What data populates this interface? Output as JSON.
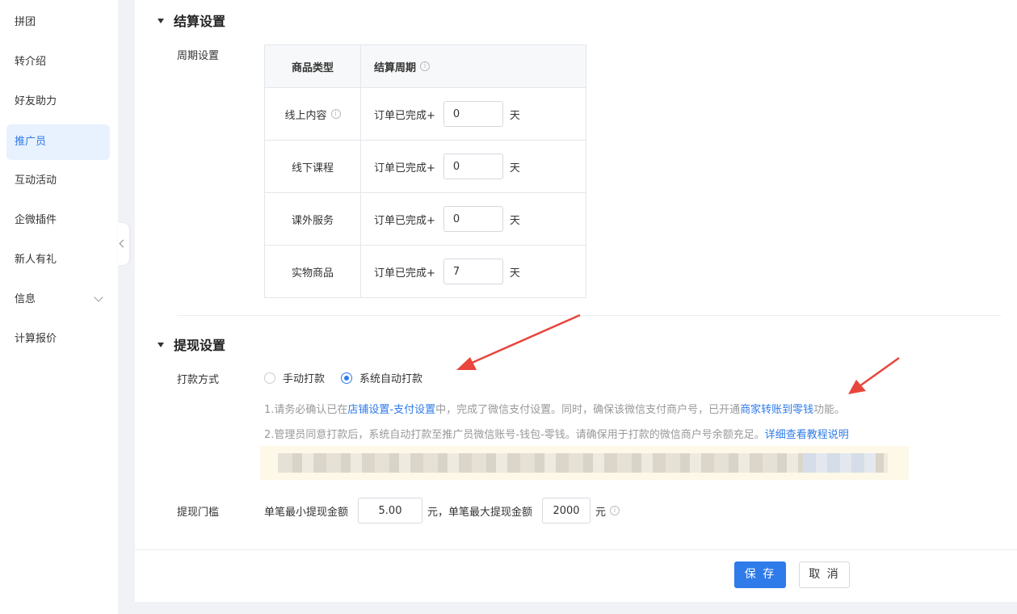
{
  "sidebar": {
    "items": [
      {
        "label": "拼团"
      },
      {
        "label": "转介绍"
      },
      {
        "label": "好友助力"
      },
      {
        "label": "推广员",
        "active": true
      },
      {
        "label": "互动活动"
      },
      {
        "label": "企微插件"
      },
      {
        "label": "新人有礼"
      },
      {
        "label": "信息",
        "has_chevron": true
      },
      {
        "label": "计算报价"
      }
    ]
  },
  "settlement": {
    "title": "结算设置",
    "period_label": "周期设置",
    "table": {
      "header_type": "商品类型",
      "header_period": "结算周期",
      "prefix": "订单已完成+",
      "unit": "天",
      "rows": [
        {
          "type": "线上内容",
          "days": "0",
          "has_info": true
        },
        {
          "type": "线下课程",
          "days": "0"
        },
        {
          "type": "课外服务",
          "days": "0"
        },
        {
          "type": "实物商品",
          "days": "7"
        }
      ]
    }
  },
  "withdraw": {
    "title": "提现设置",
    "method_label": "打款方式",
    "options": [
      {
        "label": "手动打款",
        "checked": false
      },
      {
        "label": "系统自动打款",
        "checked": true
      }
    ],
    "note1": {
      "a": "1.请务必确认已在",
      "link1": "店铺设置-支付设置",
      "b": "中，完成了微信支付设置。同时，确保该微信支付商户号，已开通",
      "link2": "商家转账到零钱",
      "c": "功能。"
    },
    "note2": {
      "a": "2.管理员同意打款后，系统自动打款至推广员微信账号-钱包-零钱。请确保用于打款的微信商户号余额充足。",
      "link": "详细查看教程说明"
    },
    "threshold_label": "提现门槛",
    "min_label": "单笔最小提现金额",
    "min_value": "5.00",
    "mid_label": "元，单笔最大提现金额",
    "max_value": "2000",
    "unit": "元"
  },
  "footer": {
    "save": "保 存",
    "cancel": "取 消"
  },
  "colors": {
    "accent": "#2f7bea",
    "annotation_arrow": "#e8453c"
  }
}
